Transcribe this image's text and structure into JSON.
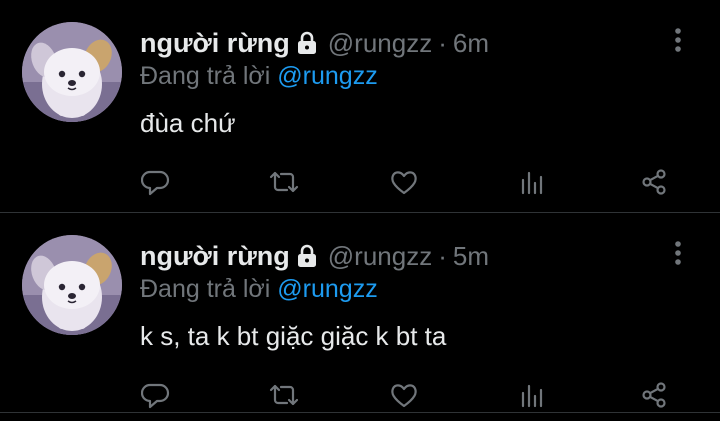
{
  "tweets": [
    {
      "display_name": "người rừng",
      "handle": "@rungzz",
      "separator": "·",
      "time": "6m",
      "reply_prefix": "Đang trả lời",
      "reply_to": "@rungzz",
      "text": "đùa chứ"
    },
    {
      "display_name": "người rừng",
      "handle": "@rungzz",
      "separator": "·",
      "time": "5m",
      "reply_prefix": "Đang trả lời",
      "reply_to": "@rungzz",
      "text": "k s, ta k bt giặc giặc k bt ta"
    }
  ],
  "icons": {
    "lock": "lock-icon",
    "more": "more-vertical-icon",
    "reply": "reply-icon",
    "retweet": "retweet-icon",
    "like": "heart-icon",
    "views": "views-icon",
    "share": "share-icon"
  },
  "colors": {
    "background": "#000000",
    "text_primary": "#e7e9ea",
    "text_secondary": "#71767b",
    "accent": "#1d9bf0",
    "divider": "#2f3336"
  }
}
